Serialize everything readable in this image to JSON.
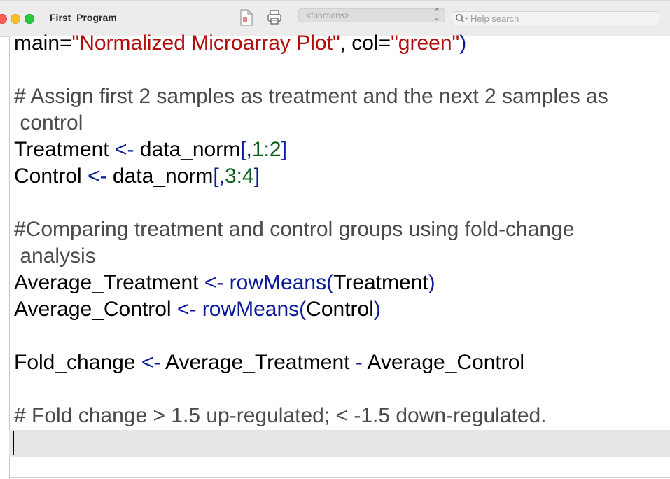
{
  "window": {
    "title": "First_Program"
  },
  "toolbar": {
    "functions_label": "<functions>",
    "search_placeholder": "Help search"
  },
  "editor": {
    "line1": {
      "a": "main=",
      "b": "\"Normalized Microarray Plot\"",
      "c": ", col=",
      "d": "\"green\"",
      "e": ")"
    },
    "line2": {
      "text": "# Assign first 2 samples as treatment and the next 2 samples as"
    },
    "line3": {
      "text": " control"
    },
    "line4": {
      "a": "Treatment ",
      "b": "<-",
      "c": " data_norm",
      "d": "[,",
      "e": "1:2",
      "f": "]"
    },
    "line5": {
      "a": "Control ",
      "b": "<-",
      "c": " data_norm",
      "d": "[,",
      "e": "3:4",
      "f": "]"
    },
    "line6": {
      "text": "#Comparing treatment and control groups using fold-change"
    },
    "line7": {
      "text": " analysis"
    },
    "line8": {
      "a": "Average_Treatment ",
      "b": "<-",
      "c": " rowMeans",
      "d": "(",
      "e": "Treatment",
      "f": ")"
    },
    "line9": {
      "a": "Average_Control ",
      "b": "<-",
      "c": " rowMeans",
      "d": "(",
      "e": "Control",
      "f": ")"
    },
    "line10": {
      "a": "Fold_change ",
      "b": "<-",
      "c": " Average_Treatment ",
      "d": "-",
      "e": " Average_Control"
    },
    "line11": {
      "text": "# Fold change > 1.5 up-regulated; < -1.5 down-regulated."
    }
  },
  "colors": {
    "comment": "#4b4b4b",
    "string": "#b40d0d",
    "number": "#0c5f1e",
    "operator": "#0a1a99",
    "current_line": "#e6e6e6"
  },
  "icons": [
    "close-icon",
    "minimize-icon",
    "zoom-icon",
    "document-icon",
    "print-icon",
    "chevron-updown-icon",
    "search-icon"
  ]
}
